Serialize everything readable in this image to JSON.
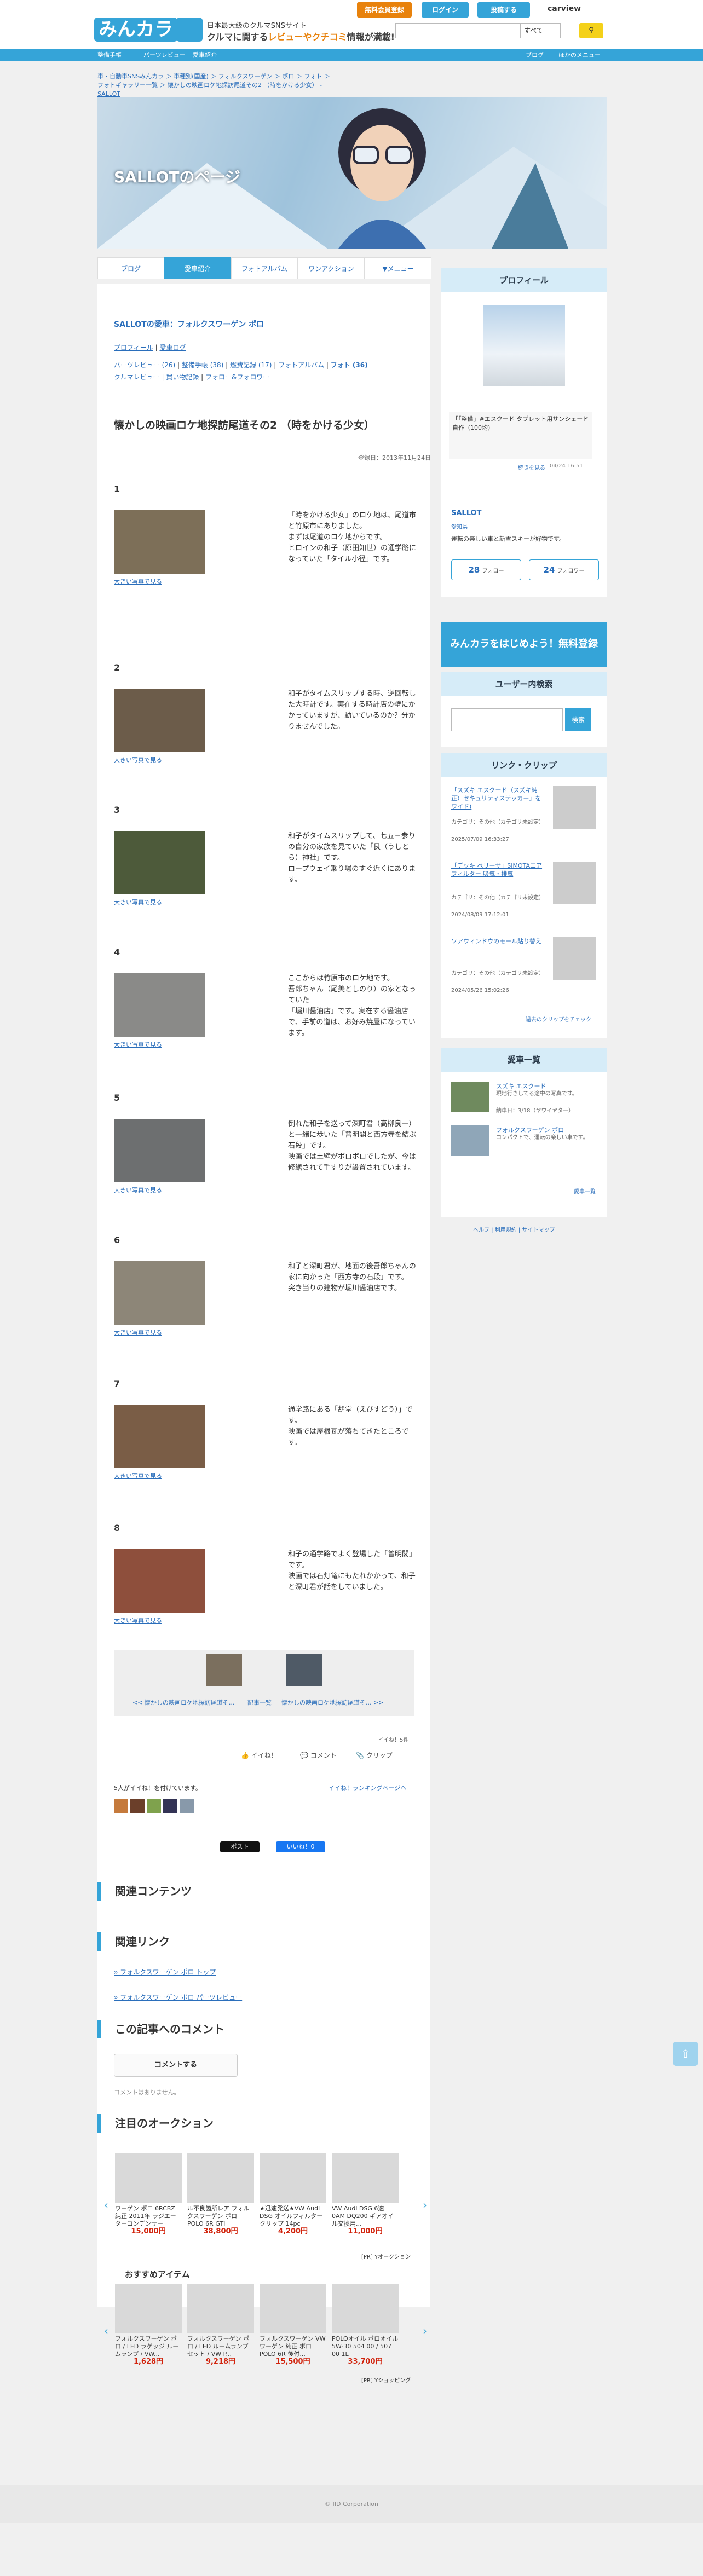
{
  "header": {
    "logo": "みんカラ",
    "tagline1": "日本最大級のクルマSNSサイト",
    "tagline2a": "クルマに関する",
    "tagline2b": "レビューや",
    "tagline2c": "クチコミ",
    "tagline2d": "情報が満載!",
    "register": "無料会員登録",
    "login": "ログイン",
    "post": "投稿する",
    "carview": "carview",
    "search_scope": "すべて"
  },
  "nav": {
    "items": [
      "整備手帳",
      "パーツレビュー",
      "愛車紹介"
    ],
    "right": [
      "ブログ",
      "ほかのメニュー"
    ]
  },
  "breadcrumb": "車・自動車SNSみんカラ ＞ 車種別(国産) ＞ フォルクスワーゲン ＞ ポロ ＞ フォト ＞ フォトギャラリー一覧 ＞ 懐かしの映画ロケ地探訪尾道その2 （時をかける少女） - SALLOT",
  "hero": {
    "title": "SALLOTのページ"
  },
  "tabs": [
    "ブログ",
    "愛車紹介",
    "フォトアルバム",
    "ワンアクション",
    "▼メニュー"
  ],
  "album": {
    "car_link": "SALLOTの愛車：フォルクスワーゲン ポロ",
    "links1": [
      "プロフィール",
      "愛車ログ"
    ],
    "links2": [
      "パーツレビュー (26)",
      "整備手帳 (38)",
      "燃費記録 (17)",
      "フォトアルバム",
      "フォト (36)"
    ],
    "links3": [
      "クルマレビュー",
      "買い物記録",
      "フォロー&フォロワー"
    ],
    "title": "懐かしの映画ロケ地探訪尾道その2 （時をかける少女）",
    "date": "登録日：2013年11月24日",
    "big_label": "大きい写真で見る",
    "steps": [
      {
        "num": "1",
        "text": "「時をかける少女」のロケ地は、尾道市と竹原市にありました。\nまずは尾道のロケ地からです。\nヒロインの和子（原田知世）の通学路になっていた「タイル小径」です。"
      },
      {
        "num": "2",
        "text": "和子がタイムスリップする時、逆回転した大時計です。実在する時計店の壁にかかっていますが、動いているのか？分かりませんでした。"
      },
      {
        "num": "3",
        "text": "和子がタイムスリップして、七五三参りの自分の家族を見ていた「艮（うしとら）神社」です。\nロープウェイ乗り場のすぐ近くにあります。"
      },
      {
        "num": "4",
        "text": "ここからは竹原市のロケ地です。\n吾郎ちゃん（尾美としのり）の家となっていた\n「堀川醤油店」です。実在する醤油店で、手前の道は、お好み焼屋になっています。"
      },
      {
        "num": "5",
        "text": "倒れた和子を送って深町君（高柳良一）と一緒に歩いた「普明閣と西方寺を結ぶ石段」です。\n映画では土壁がボロボロでしたが、今は修繕されて手すりが設置されています。"
      },
      {
        "num": "6",
        "text": "和子と深町君が、地面の後吾郎ちゃんの家に向かった「西方寺の石段」です。\n突き当りの建物が堀川醤油店です。"
      },
      {
        "num": "7",
        "text": "通学路にある「胡堂（えびすどう）」です。\n映画では屋根瓦が落ちてきたところです。"
      },
      {
        "num": "8",
        "text": "和子の通学路でよく登場した「普明閣」です。\n映画では石灯篭にもたれかかって、和子と深町君が話をしていました。"
      }
    ],
    "prev_link": "<< 懐かしの映画ロケ地探訪尾道そ...",
    "list_link": "記事一覧",
    "next_link": "懐かしの映画ロケ地探訪尾道そ... >>",
    "iine_count": "イイね！5件",
    "iine": "イイね！",
    "comment": "コメント",
    "clip": "クリップ",
    "iine_users": "5人がイイね！を付けています。",
    "iine_ranking": "イイね！ランキングページへ",
    "tweet": "ポスト",
    "fb": "いいね！0"
  },
  "sections": {
    "related": "関連コンテンツ",
    "related_links": "関連リンク",
    "link1": "» フォルクスワーゲン ポロ トップ",
    "link2": "» フォルクスワーゲン ポロ パーツレビュー",
    "comment_title": "この記事へのコメント",
    "comment_button": "コメントする",
    "no_comment": "コメントはありません。",
    "auction": "注目のオークション",
    "recommend": "おすすめアイテム"
  },
  "auctions": [
    {
      "name": "ワーゲン ポロ 6RCBZ 純正 2011年 ラジエーターコンデンサー",
      "price": "15,000円"
    },
    {
      "name": "ル不良箇所レア フォルクスワーゲン ポロ POLO 6R GTI",
      "price": "38,800円"
    },
    {
      "name": "★迅速発送★VW Audi DSG オイルフィルタークリップ 14pc",
      "price": "4,200円"
    },
    {
      "name": "VW Audi DSG 6速 0AM DQ200 ギアオイル交換用...",
      "price": "11,000円"
    }
  ],
  "auction_source": "[PR] Yオークション",
  "items": [
    {
      "name": "フォルクスワーゲン ポロ / LED ラゲッジ ルームランプ / VW...",
      "price": "1,628円"
    },
    {
      "name": "フォルクスワーゲン ポロ / LED ルームランプセット / VW P...",
      "price": "9,218円"
    },
    {
      "name": "フォルクスワーゲン VW ワーゲン 純正 ポロ POLO 6R 後付...",
      "price": "15,500円"
    },
    {
      "name": "POLOオイル ポロオイル 5W-30 504 00 / 507 00 1L",
      "price": "33,700円"
    }
  ],
  "item_source": "[PR] Yショッピング",
  "sidebar": {
    "profile_title": "プロフィール",
    "profile_text": "「「整備」#エスクード タブレット用サンシェード自作（100均）",
    "profile_more": "続きを見る",
    "profile_date": "04/24 16:51",
    "user": "SALLOT",
    "user_sub": "愛知県",
    "user_desc": "運転の楽しい車と新雪スキーが好物です。",
    "follow": "28",
    "follow_label": "フォロー",
    "follower": "24",
    "follower_label": "フォロワー",
    "banner": "みんカラをはじめよう！無料登録",
    "search_title": "ユーザー内検索",
    "search_btn": "検索",
    "clip_title": "リンク・クリップ",
    "clips": [
      {
        "title": "「スズキ エスクード（スズキ純正）セキュリティステッカー」をワイド)",
        "meta": "カテゴリ：その他（カテゴリ未設定）",
        "date": "2025/07/09 16:33:27"
      },
      {
        "title": "「デッキ ベリーサ」SIMOTAエアフィルター 吸気・排気",
        "meta": "カテゴリ：その他（カテゴリ未設定）",
        "date": "2024/08/09 17:12:01"
      },
      {
        "title": "ソアウィンドウのモール貼り替え",
        "meta": "カテゴリ：その他（カテゴリ未設定）",
        "date": "2024/05/26 15:02:26"
      }
    ],
    "clip_more": "過去のクリップをチェック",
    "car_title": "愛車一覧",
    "cars": [
      {
        "name": "スズキ エスクード",
        "desc": "現地行きしてる途中の写真です。",
        "meta": "納車日：3/18（ヤウイヤター）"
      },
      {
        "name": "フォルクスワーゲン ポロ",
        "desc": "コンパクトで、運転の楽しい車です。",
        "meta": ""
      }
    ],
    "car_more": "愛車一覧",
    "bottom_links": [
      "ヘルプ",
      "利用規約",
      "サイトマップ"
    ]
  },
  "footer": "© IID Corporation"
}
